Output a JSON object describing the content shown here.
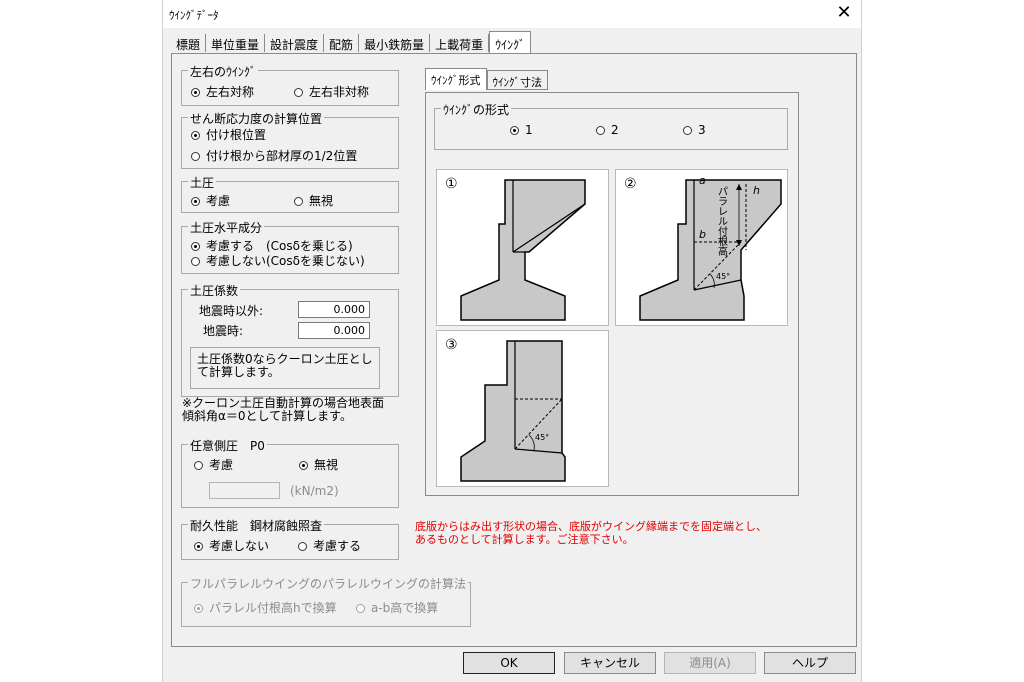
{
  "window": {
    "title": "ｳｲﾝｸﾞﾃﾞｰﾀ",
    "close_glyph": "✕"
  },
  "tabs": [
    "標題",
    "単位重量",
    "設計震度",
    "配筋",
    "最小鉄筋量",
    "上載荷重",
    "ｳｲﾝｸﾞ"
  ],
  "active_tab": 6,
  "left_right": {
    "legend": "左右のｳｲﾝｸﾞ",
    "options": [
      "左右対称",
      "左右非対称"
    ],
    "selected": 0
  },
  "shear_pos": {
    "legend": "せん断応力度の計算位置",
    "options": [
      "付け根位置",
      "付け根から部材厚の1/2位置"
    ],
    "selected": 0
  },
  "earth_pressure": {
    "legend": "土圧",
    "options": [
      "考慮",
      "無視"
    ],
    "selected": 0
  },
  "earth_horiz": {
    "legend": "土圧水平成分",
    "options": [
      "考慮する　(Cosδを乗じる)",
      "考慮しない(Cosδを乗じない)"
    ],
    "selected": 0
  },
  "earth_coef": {
    "legend": "土圧係数",
    "non_quake_label": "地震時以外:",
    "non_quake_value": "0.000",
    "quake_label": "地震時:",
    "quake_value": "0.000",
    "note": "土圧係数0ならクーロン土圧として計算します。"
  },
  "coulomb_note": "※クーロン土圧自動計算の場合地表面傾斜角α＝0として計算します。",
  "arbitrary_pressure": {
    "legend": "任意側圧　P0",
    "options": [
      "考慮",
      "無視"
    ],
    "selected": 1,
    "value": "",
    "unit": "(kN/m2)"
  },
  "durability": {
    "legend": "耐久性能　鋼材腐蝕照査",
    "options": [
      "考慮しない",
      "考慮する"
    ],
    "selected": 0
  },
  "full_parallel": {
    "legend": "フルパラレルウイングのパラレルウイングの計算法",
    "options": [
      "パラレル付根高hで換算",
      "a-b高で換算"
    ],
    "selected": 0
  },
  "wing_tabs": [
    "ｳｲﾝｸﾞ形式",
    "ｳｲﾝｸﾞ寸法"
  ],
  "wing_active_tab": 0,
  "wing_type": {
    "legend": "ｳｲﾝｸﾞの形式",
    "options": [
      "1",
      "2",
      "3"
    ],
    "selected": 0
  },
  "images": [
    {
      "num": "①"
    },
    {
      "num": "②",
      "label_a": "a",
      "label_b": "b",
      "label_h": "h",
      "vertical_text": "パラレル付根高",
      "angle": "45°"
    },
    {
      "num": "③",
      "angle": "45°"
    }
  ],
  "warning": "底版からはみ出す形状の場合、底版がウイング縁端までを固定端とし、\nあるものとして計算します。ご注意下さい。",
  "buttons": {
    "ok": "OK",
    "cancel": "キャンセル",
    "apply": "適用(A)",
    "help": "ヘルプ"
  },
  "colors": {
    "fill": "#c8c8c8",
    "stroke": "#000000",
    "warning": "#e00000"
  }
}
